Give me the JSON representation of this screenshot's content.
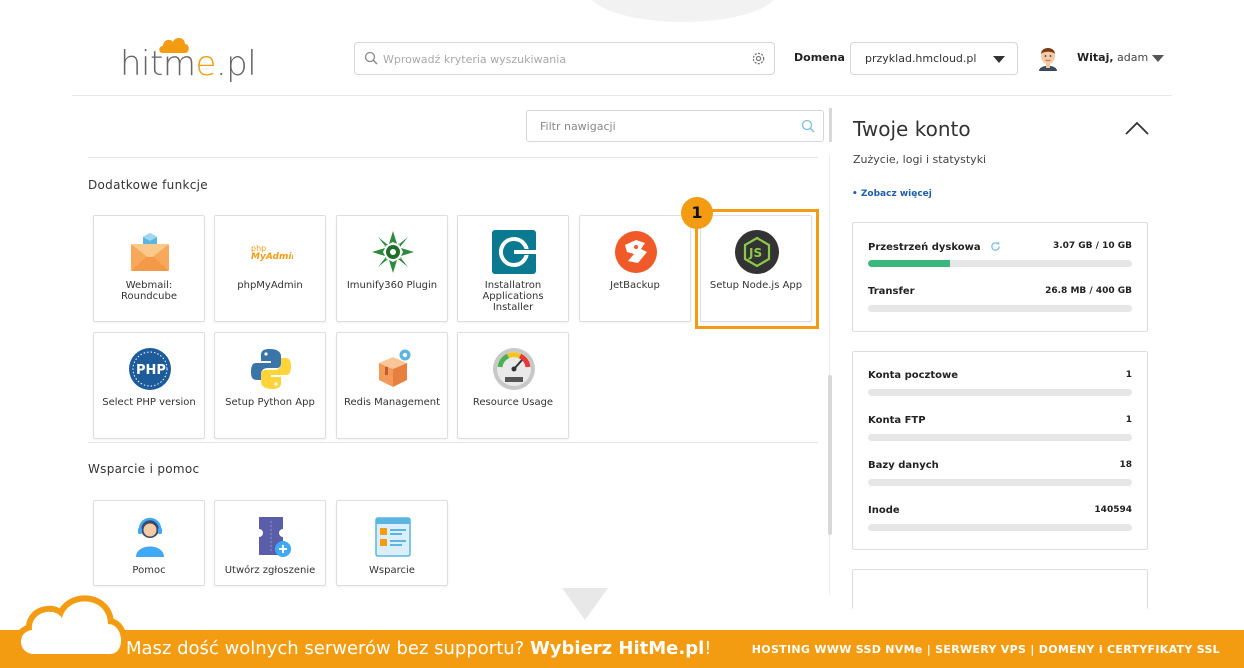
{
  "header": {
    "logo": {
      "text_a": "hitm",
      "text_o": "e",
      "text_b": ".pl"
    },
    "search": {
      "placeholder": "Wprowadź kryteria wyszukiwania"
    },
    "domain_label": "Domena",
    "domain_value": "przyklad.hmcloud.pl",
    "greeting_prefix": "Witaj,",
    "greeting_user": "adam"
  },
  "nav": {
    "filter_placeholder": "Filtr nawigacji"
  },
  "sections": [
    {
      "title": "Dodatkowe funkcje",
      "tiles": [
        {
          "label": "Webmail: Roundcube",
          "icon": "webmail-envelope-icon"
        },
        {
          "label": "phpMyAdmin",
          "icon": "phpmyadmin-icon"
        },
        {
          "label": "Imunify360 Plugin",
          "icon": "imunify360-icon"
        },
        {
          "label": "Installatron Applications Installer",
          "icon": "installatron-icon"
        },
        {
          "label": "JetBackup",
          "icon": "jetbackup-icon"
        },
        {
          "label": "Setup Node.js App",
          "icon": "nodejs-icon"
        },
        {
          "label": "Select PHP version",
          "icon": "php-icon"
        },
        {
          "label": "Setup Python App",
          "icon": "python-icon"
        },
        {
          "label": "Redis Management",
          "icon": "redis-box-icon"
        },
        {
          "label": "Resource Usage",
          "icon": "gauge-icon"
        }
      ]
    },
    {
      "title": "Wsparcie i pomoc",
      "tiles": [
        {
          "label": "Pomoc",
          "icon": "support-agent-icon"
        },
        {
          "label": "Utwórz zgłoszenie",
          "icon": "create-ticket-icon"
        },
        {
          "label": "Wsparcie",
          "icon": "support-docs-icon"
        }
      ]
    }
  ],
  "annotation": {
    "badge": "1"
  },
  "account": {
    "title": "Twoje konto",
    "subtitle": "Zużycie, logi i statystyki",
    "more_link": "• Zobacz więcej",
    "disk": [
      {
        "name": "Przestrzeń dyskowa",
        "value": "3.07 GB / 10 GB",
        "fraction": 0.31
      },
      {
        "name": "Transfer",
        "value": "26.8 MB / 400 GB",
        "fraction": 0.0
      }
    ],
    "counts": [
      {
        "name": "Konta pocztowe",
        "value": "1"
      },
      {
        "name": "Konta FTP",
        "value": "1"
      },
      {
        "name": "Bazy danych",
        "value": "18"
      },
      {
        "name": "Inode",
        "value": "140594"
      }
    ]
  },
  "footer": {
    "message": "Masz dość wolnych serwerów bez supportu?",
    "cta": "Wybierz HitMe.pl",
    "bang": "!",
    "services": "HOSTING WWW SSD NVMe | SERWERY VPS | DOMENY i CERTYFIKATY SSL"
  },
  "colors": {
    "brand_orange": "#f39c12",
    "progress_green": "#3bb77e",
    "link_blue": "#1f5fa8"
  }
}
